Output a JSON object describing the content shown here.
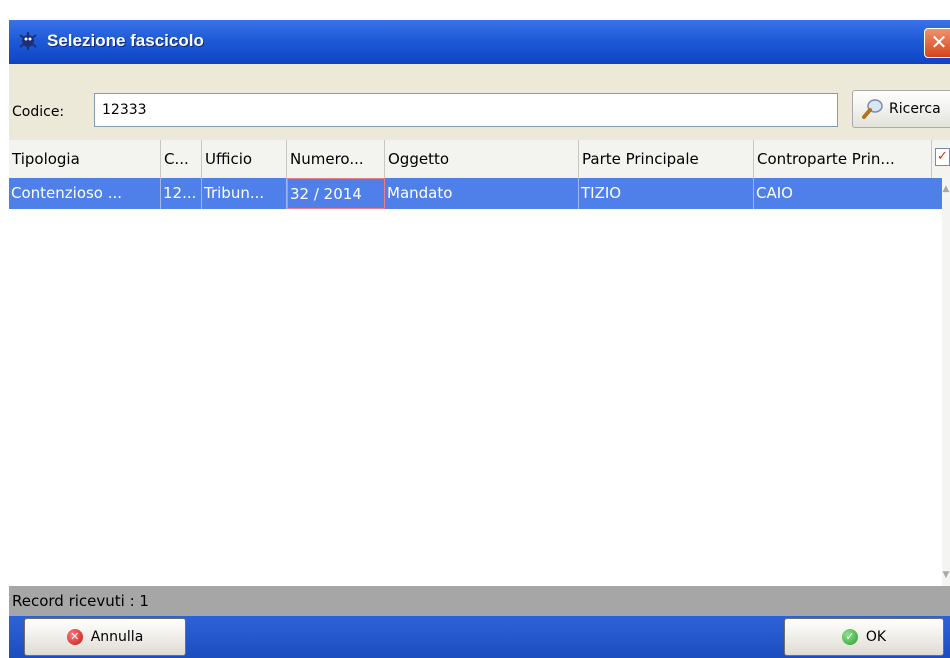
{
  "window": {
    "title": "Selezione fascicolo",
    "close_glyph": "✕"
  },
  "search": {
    "label": "Codice:",
    "value": "12333",
    "button_label": "Ricerca"
  },
  "grid": {
    "columns": [
      "Tipologia",
      "C...",
      "Ufficio",
      "Numero...",
      "Oggetto",
      "Parte Principale",
      "Controparte Prin..."
    ],
    "rows": [
      [
        "Contenzioso ...",
        "12...",
        "Tribun...",
        "32 / 2014",
        "Mandato",
        "TIZIO",
        "CAIO"
      ]
    ],
    "selected_row": 0,
    "column_chooser_icon": "checkbox-list-icon"
  },
  "status": {
    "text": "Record ricevuti : 1"
  },
  "footer": {
    "cancel_label": "Annulla",
    "ok_label": "OK"
  },
  "colors": {
    "titlebar": "#1f5bd7",
    "selection": "#4f80ea",
    "footer": "#2458d0",
    "status_bar": "#a6a6a6"
  }
}
